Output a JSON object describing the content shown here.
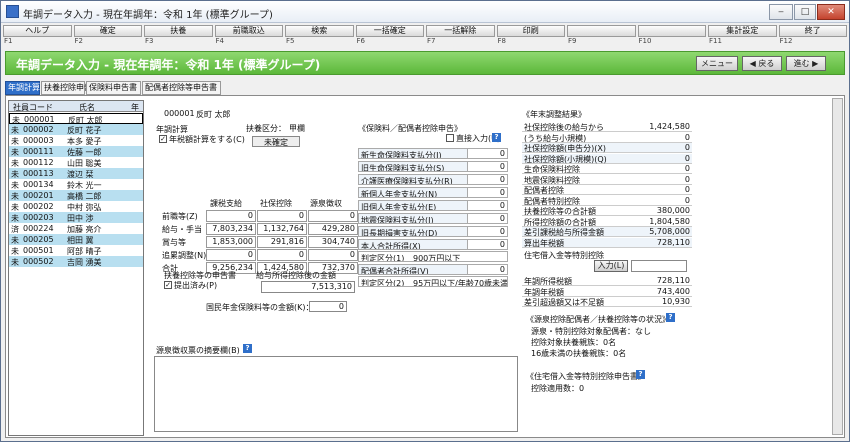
{
  "window": {
    "title": "年調データ入力 - 現在年調年：令和 1年 (標準グループ)"
  },
  "fkeys": [
    {
      "num": "F1",
      "label": "ヘルプ"
    },
    {
      "num": "F2",
      "label": "確定"
    },
    {
      "num": "F3",
      "label": "扶養"
    },
    {
      "num": "F4",
      "label": "前職取込"
    },
    {
      "num": "F5",
      "label": "検索"
    },
    {
      "num": "F6",
      "label": "一括確定"
    },
    {
      "num": "F7",
      "label": "一括解除"
    },
    {
      "num": "F8",
      "label": "印刷"
    },
    {
      "num": "F9",
      "label": ""
    },
    {
      "num": "F10",
      "label": ""
    },
    {
      "num": "F11",
      "label": "集計設定"
    },
    {
      "num": "F12",
      "label": "終了"
    }
  ],
  "banner": {
    "title": "年調データ入力 - 現在年調年：令和 1年 (標準グループ)",
    "menu": "メニュー",
    "back": "◀ 戻る",
    "next": "進む ▶"
  },
  "tabs": [
    "年調計算",
    "扶養控除申告書",
    "保険料申告書",
    "配偶者控除等申告書"
  ],
  "employee_list": {
    "headers": {
      "code": "社員コード",
      "name": "氏名",
      "rank": "年"
    },
    "rows": [
      {
        "mark": "未",
        "code": "000001",
        "name": "反町 太郎"
      },
      {
        "mark": "未",
        "code": "000002",
        "name": "反町 花子"
      },
      {
        "mark": "未",
        "code": "000003",
        "name": "本多 愛子"
      },
      {
        "mark": "未",
        "code": "000111",
        "name": "佐藤 一郎"
      },
      {
        "mark": "未",
        "code": "000112",
        "name": "山田 聡美"
      },
      {
        "mark": "未",
        "code": "000113",
        "name": "渡辺 栞"
      },
      {
        "mark": "未",
        "code": "000134",
        "name": "鈴木 光一"
      },
      {
        "mark": "未",
        "code": "000201",
        "name": "高橋 二郎"
      },
      {
        "mark": "未",
        "code": "000202",
        "name": "中村 弥弘"
      },
      {
        "mark": "未",
        "code": "000203",
        "name": "田中 渉"
      },
      {
        "mark": "済",
        "code": "000224",
        "name": "加藤 亮介"
      },
      {
        "mark": "未",
        "code": "000205",
        "name": "相田 翼"
      },
      {
        "mark": "未",
        "code": "000501",
        "name": "阿部 晴子"
      },
      {
        "mark": "未",
        "code": "000502",
        "name": "吉岡 湧美"
      }
    ]
  },
  "employee": {
    "code": "000001",
    "name": "反町 太郎"
  },
  "nencho": {
    "label": "年調計算",
    "checkbox": "年税額計算をする(C)",
    "fuyo_label": "扶養区分：",
    "fuyo_value": "甲欄",
    "status": "未確定"
  },
  "pay_table": {
    "headers": [
      "課税支給",
      "社保控除",
      "源泉徴収"
    ],
    "rows": [
      {
        "label": "前職等(Z)",
        "values": [
          "0",
          "0",
          "0"
        ]
      },
      {
        "label": "給与・手当",
        "values": [
          "7,803,234",
          "1,132,764",
          "429,280"
        ]
      },
      {
        "label": "賞与等",
        "values": [
          "1,853,000",
          "291,816",
          "304,740"
        ]
      },
      {
        "label": "追累調整(N)",
        "values": [
          "0",
          "0",
          "0"
        ]
      },
      {
        "label": "合計",
        "values": [
          "9,256,234",
          "1,424,580",
          "732,370"
        ]
      }
    ]
  },
  "fuyo_shinkoku": {
    "title": "扶養控除等の申告書",
    "checkbox": "提出済み(P)"
  },
  "kyuyo_shotoku": {
    "title": "給与所得控除後の金額",
    "value": "7,513,310"
  },
  "kokumin": {
    "label": "国民年金保険料等の金額(K)：",
    "value": "0"
  },
  "gensen_note": {
    "label": "源泉徴収票の摘要欄(B)"
  },
  "hoken": {
    "title": "《保険料／配偶者控除申告》",
    "direct": "直接入力(U)",
    "rows": [
      {
        "label": "新生命保険料支払分(I)",
        "value": "0"
      },
      {
        "label": "旧生命保険料支払分(S)",
        "value": "0"
      },
      {
        "label": "介護医療保険料支払分(R)",
        "value": "0"
      },
      {
        "label": "新個人年金支払分(N)",
        "value": "0"
      },
      {
        "label": "旧個人年金支払分(E)",
        "value": "0"
      },
      {
        "label": "地震保険料支払分(J)",
        "value": "0"
      },
      {
        "label": "旧長期損害支払分(D)",
        "value": "0"
      }
    ],
    "honnin_label": "本人合計所得(X)",
    "honnin_value": "0",
    "hantei_label": "判定区分(1)",
    "hantei_value": "900万円以下",
    "haigu_label": "配偶者合計所得(V)",
    "haigu_value": "0",
    "hantei2_label": "判定区分(2)",
    "hantei2_value": "95万円以下/年齢70歳未満"
  },
  "nenmatsu": {
    "title": "《年末調整結果》",
    "rows": [
      {
        "label": "社保控除後の給与から",
        "value": "1,424,580",
        "hl": false
      },
      {
        "label": "(うち給与小規模)",
        "value": "0",
        "hl": false
      },
      {
        "label": "社保控除額(申告分)(X)",
        "value": "0",
        "hl": true
      },
      {
        "label": "社保控除額(小規模)(Q)",
        "value": "0",
        "hl": true
      },
      {
        "label": "生命保険料控除",
        "value": "0",
        "hl": false
      },
      {
        "label": "地震保険料控除",
        "value": "0",
        "hl": false
      },
      {
        "label": "配偶者控除",
        "value": "0",
        "hl": false
      },
      {
        "label": "配偶者特別控除",
        "value": "0",
        "hl": false
      },
      {
        "label": "扶養控除等の合計額",
        "value": "380,000",
        "hl": false
      },
      {
        "label": "所得控除額の合計額",
        "value": "1,804,580",
        "hl": false
      },
      {
        "label": "差引課税給与所得金額",
        "value": "5,708,000",
        "hl": true
      },
      {
        "label": "算出年税額",
        "value": "728,110",
        "hl": true
      }
    ],
    "jutaku_label": "住宅借入金等特別控除",
    "jutaku_btn": "入力(L)",
    "rows2": [
      {
        "label": "年調所得税額",
        "value": "728,110"
      },
      {
        "label": "年調年税額",
        "value": "743,400"
      },
      {
        "label": "差引超過額又は不足額",
        "value": "10,930"
      }
    ]
  },
  "haigusha": {
    "title": "《源泉控除配偶者／扶養控除等の状況》",
    "lines": [
      "源泉・特別控除対象配偶者：なし",
      "控除対象扶養親族：0名",
      "16歳未満の扶養親族：0名"
    ]
  },
  "jutaku": {
    "title": "《住宅借入金等特別控除申告書》",
    "line": "控除適用数：0"
  }
}
